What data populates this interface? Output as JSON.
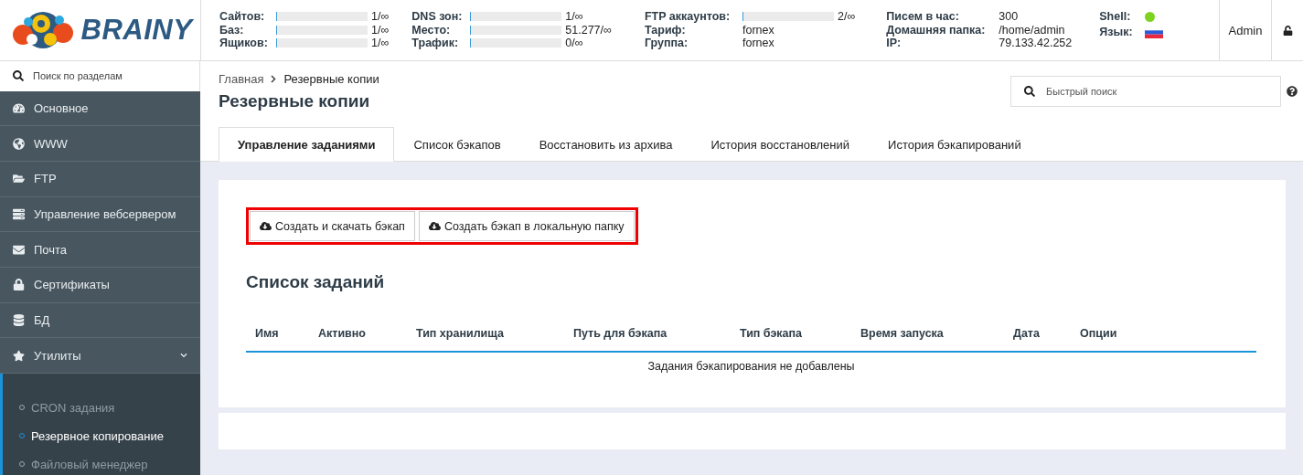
{
  "header": {
    "logo": "BRAINY",
    "stat_groups": [
      {
        "kind": "meter",
        "rows": [
          {
            "label": "Сайтов:",
            "reading": "1/∞",
            "level": 0
          },
          {
            "label": "Баз:",
            "reading": "1/∞",
            "level": 0
          },
          {
            "label": "Ящиков:",
            "reading": "1/∞",
            "level": 0
          }
        ]
      },
      {
        "kind": "meter",
        "rows": [
          {
            "label": "DNS зон:",
            "reading": "1/∞",
            "level": 0
          },
          {
            "label": "Место:",
            "reading": "51.277/∞",
            "level": 0
          },
          {
            "label": "Трафик:",
            "reading": "0/∞",
            "level": 0
          }
        ]
      },
      {
        "kind": "meter",
        "rows": [
          {
            "label": "FTP аккаунтов:",
            "reading": "2/∞",
            "level": 0
          },
          {
            "label": "Тариф:",
            "value": "fornex"
          },
          {
            "label": "Группа:",
            "value": "fornex"
          }
        ]
      },
      {
        "kind": "text",
        "rows": [
          {
            "label": "Писем в час:",
            "value": "300"
          },
          {
            "label": "Домашняя папка:",
            "value": "/home/admin"
          },
          {
            "label": "IP:",
            "value": "79.133.42.252"
          }
        ]
      },
      {
        "kind": "status",
        "rows": [
          {
            "label": "Shell:",
            "kind": "dot",
            "on": true
          },
          {
            "label": "Язык:",
            "kind": "flag"
          }
        ]
      }
    ],
    "user": "Admin"
  },
  "sidebar": {
    "search": {
      "placeholder": "Поиск по разделам"
    },
    "items": [
      {
        "label": "Основное",
        "expanded": false
      },
      {
        "label": "WWW",
        "expanded": false
      },
      {
        "label": "FTP",
        "expanded": false
      },
      {
        "label": "Управление вебсервером",
        "expanded": false
      },
      {
        "label": "Почта",
        "expanded": false
      },
      {
        "label": "Сертификаты",
        "expanded": false
      },
      {
        "label": "БД",
        "expanded": false
      },
      {
        "label": "Утилиты",
        "expanded": true,
        "children": [
          {
            "label": "CRON задания",
            "selected": false
          },
          {
            "label": "Резервное копирование",
            "selected": true
          },
          {
            "label": "Файловый менеджер",
            "selected": false
          }
        ]
      }
    ]
  },
  "breadcrumb": [
    "Главная",
    "Резервные копии"
  ],
  "title": "Резервные копии",
  "quick_search": {
    "placeholder": "Быстрый поиск"
  },
  "tabs": [
    {
      "label": "Управление заданиями",
      "selected": true
    },
    {
      "label": "Список бэкапов",
      "selected": false
    },
    {
      "label": "Восстановить из архива",
      "selected": false
    },
    {
      "label": "История восстановлений",
      "selected": false
    },
    {
      "label": "История бэкапирований",
      "selected": false
    }
  ],
  "actions": [
    "Создать и скачать бэкап",
    "Создать бэкап в локальную папку"
  ],
  "tasks": {
    "title": "Список заданий",
    "columns": [
      "Имя",
      "Активно",
      "Тип хранилища",
      "Путь для бэкапа",
      "Тип бэкапа",
      "Время запуска",
      "Дата",
      "Опции"
    ],
    "empty": "Задания бэкапирования не добавлены"
  }
}
